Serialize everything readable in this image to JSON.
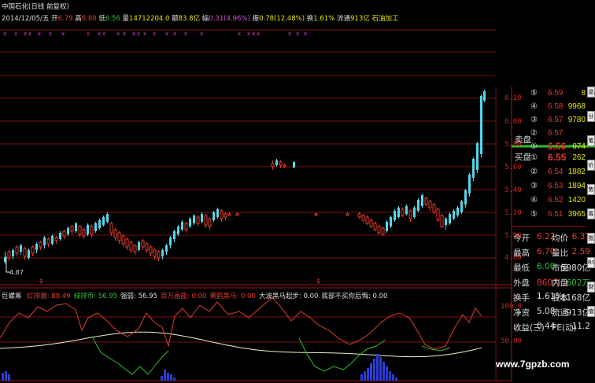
{
  "header": {
    "title": "中国石化(日线 前复权)",
    "date": "2014/12/05/五",
    "open_label": "开",
    "open_value": "6.79",
    "high_label": "高",
    "high_value": "6.80",
    "low_label": "低",
    "low_value": "6.56",
    "volume_label": "量",
    "volume_value": "14712204.0",
    "amount_label": "额",
    "amount_value": "83.8亿",
    "change_label": "幅",
    "change_value": "0.31(4.96%)",
    "amplitude_label": "振",
    "amplitude_value": "0.78(12.48%)",
    "turnover_label": "换",
    "turnover_value": "1.61%",
    "float_label": "流通",
    "float_value": "913亿",
    "industry": "石油加工"
  },
  "price_axis": {
    "ticks": [
      "6.20",
      "6.00",
      "5.80",
      "5.60",
      "5.40",
      "5.20",
      "5.00",
      "4.80"
    ],
    "low_marker": "4.87"
  },
  "indicator": {
    "name": "巨螺筹",
    "items": [
      {
        "label": "红排撤:",
        "value": "88.49",
        "color": "#e03c2c"
      },
      {
        "label": "绿排币:",
        "value": "56.95",
        "color": "#2fbf2f"
      },
      {
        "label": "强弱:",
        "value": "56.95",
        "color": "#dddddd"
      },
      {
        "label": "百万画能:",
        "value": "0.00",
        "color": "#e03c2c"
      },
      {
        "label": "黄鹤黑马:",
        "value": "0.00",
        "color": "#e03c2c"
      },
      {
        "label": "大波黑马起步:",
        "value": "0.00",
        "color": "#dddddd"
      },
      {
        "label": "底部不买你后悔:",
        "value": "0.00",
        "color": "#dddddd"
      }
    ],
    "ticks": [
      "100.0",
      "50.00"
    ]
  },
  "order_book": {
    "asks": [
      {
        "level": "5",
        "price": "6.59",
        "volume": "8"
      },
      {
        "level": "4",
        "price": "6.58",
        "volume": "9968"
      },
      {
        "level": "3",
        "price": "6.57",
        "volume": "9780"
      },
      {
        "level": "2",
        "price": "6.57",
        "volume": ""
      },
      {
        "level": "1",
        "price": "6.56",
        "volume": "974"
      }
    ],
    "ask_label": "卖盘",
    "bid_label": "买盘",
    "bids": [
      {
        "level": "1",
        "price": "6.55",
        "volume": "262"
      },
      {
        "level": "2",
        "price": "6.54",
        "volume": "1882"
      },
      {
        "level": "3",
        "price": "6.53",
        "volume": "1894"
      },
      {
        "level": "4",
        "price": "6.52",
        "volume": "1420"
      },
      {
        "level": "5",
        "price": "6.51",
        "volume": "3965"
      }
    ]
  },
  "stats": [
    {
      "l1": "今开",
      "v1": "6.22",
      "c1": "#e03c2c",
      "l2": "均价",
      "v2": "6.37",
      "c2": "#e03c2c"
    },
    {
      "l1": "最高",
      "v1": "6.70",
      "c1": "#e03c2c",
      "l2": "量比",
      "v2": "2.59",
      "c2": "#e03c2c"
    },
    {
      "l1": "最低",
      "v1": "6.00",
      "c1": "#2fbf2f",
      "l2": "市值",
      "v2": "5980亿",
      "c2": "#dddddd"
    },
    {
      "l1": "外盘",
      "v1": "860万",
      "c1": "#e03c2c",
      "l2": "内盘",
      "v2": "602万",
      "c2": "#2fbf2f"
    },
    {
      "l1": "换手",
      "v1": "1.61%",
      "c1": "#dddddd",
      "l2": "股本",
      "v2": "1168亿",
      "c2": "#dddddd"
    },
    {
      "l1": "净资",
      "v1": "5.08",
      "c1": "#dddddd",
      "l2": "流通",
      "v2": "913亿",
      "c2": "#dddddd"
    },
    {
      "l1": "收益(三)",
      "v1": "0.44",
      "c1": "#dddddd",
      "l2": "PE(动)",
      "v2": "11.2",
      "c2": "#dddddd"
    }
  ],
  "side_buttons": [
    "品",
    "分",
    "笔",
    "价",
    "势",
    "筹",
    "指",
    "RSI",
    "财",
    "值"
  ],
  "watermark": "www.7gpzb.com",
  "colors": {
    "up": "#e03c2c",
    "down": "#4fd8e8",
    "grid": "#7a0f0f",
    "bg": "#000000"
  }
}
